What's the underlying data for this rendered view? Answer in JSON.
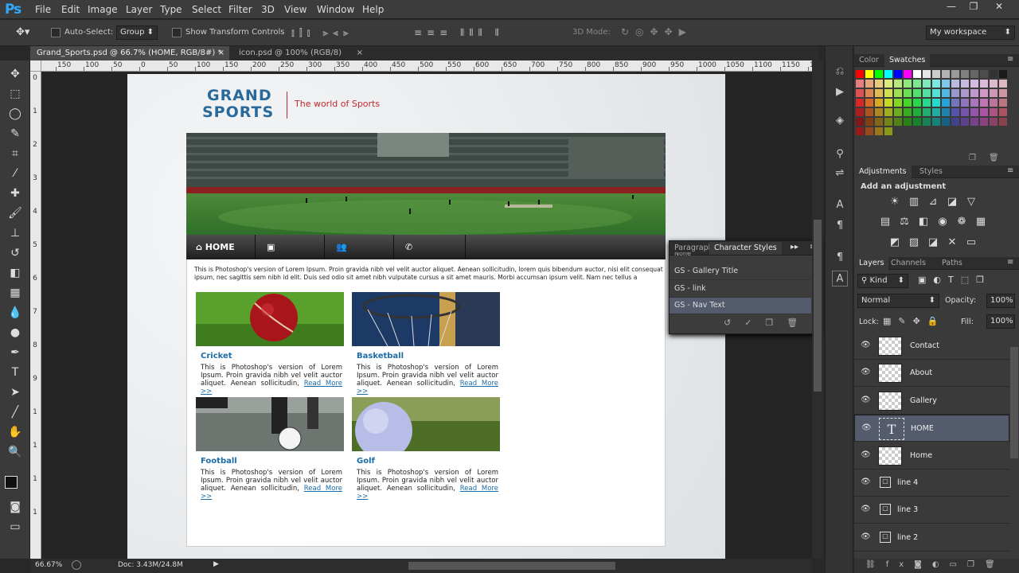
{
  "menubar": {
    "logo": "Ps",
    "items": [
      "File",
      "Edit",
      "Image",
      "Layer",
      "Type",
      "Select",
      "Filter",
      "3D",
      "View",
      "Window",
      "Help"
    ]
  },
  "options": {
    "auto_select_label": "Auto-Select:",
    "auto_select_value": "Group",
    "transform_label": "Show Transform Controls",
    "mode_3d_label": "3D Mode:",
    "workspace": "My workspace"
  },
  "tabs": [
    {
      "label": "Grand_Sports.psd @ 66.7% (HOME, RGB/8#) *"
    },
    {
      "label": "icon.psd @ 100% (RGB/8)"
    }
  ],
  "ruler": {
    "top": [
      "150",
      "100",
      "50",
      "0",
      "50",
      "100",
      "150",
      "200",
      "250",
      "300",
      "350",
      "400",
      "450",
      "500",
      "550",
      "600",
      "650",
      "700",
      "750",
      "800",
      "850",
      "900",
      "950",
      "1000",
      "1050",
      "1100",
      "1150",
      "12"
    ],
    "left": [
      "0",
      "1",
      "2",
      "3",
      "4",
      "5",
      "6",
      "7",
      "8",
      "9",
      "1",
      "1",
      "1",
      "1"
    ]
  },
  "site": {
    "logo_line1": "GRAND",
    "logo_line2": "SPORTS",
    "tagline": "The world of Sports",
    "nav_home": "HOME",
    "intro": "This is Photoshop's version  of Lorem Ipsum. Proin gravida nibh vel velit auctor aliquet. Aenean sollicitudin, lorem quis bibendum auctor, nisi elit consequat ipsum, nec sagittis sem nibh id elit. Duis sed odio sit amet nibh vulputate cursus a sit amet mauris. Morbi accumsan ipsum velit. Nam nec tellus a",
    "cards": [
      {
        "title": "Cricket",
        "text": "This is Photoshop's version  of Lorem Ipsum. Proin gravida nibh vel velit auctor aliquet. Aenean sollicitudin,",
        "more": "Read More >>"
      },
      {
        "title": "Basketball",
        "text": "This is Photoshop's version  of Lorem Ipsum. Proin gravida nibh vel velit auctor aliquet. Aenean sollicitudin,",
        "more": "Read More >>"
      },
      {
        "title": "Football",
        "text": "This is Photoshop's version  of Lorem Ipsum. Proin gravida nibh vel velit auctor aliquet. Aenean sollicitudin,",
        "more": "Read More >>"
      },
      {
        "title": "Golf",
        "text": "This is Photoshop's version  of Lorem Ipsum. Proin gravida nibh vel velit auctor aliquet. Aenean sollicitudin,",
        "more": "Read More >>"
      }
    ]
  },
  "char_panel": {
    "tab_paragraph": "Paragraph",
    "tab_char_styles": "Character Styles",
    "partial_item": "None",
    "items": [
      "GS - Gallery Title",
      "GS - link",
      "GS - Nav Text"
    ]
  },
  "status": {
    "zoom": "66.67%",
    "doc": "Doc: 3.43M/24.8M"
  },
  "color_panel": {
    "tab_color": "Color",
    "tab_swatches": "Swatches"
  },
  "adjustments": {
    "tab_adjustments": "Adjustments",
    "tab_styles": "Styles",
    "heading": "Add an adjustment"
  },
  "layers_panel": {
    "tab_layers": "Layers",
    "tab_channels": "Channels",
    "tab_paths": "Paths",
    "filter_kind": "Kind",
    "blend_mode": "Normal",
    "opacity_label": "Opacity:",
    "opacity_value": "100%",
    "lock_label": "Lock:",
    "fill_label": "Fill:",
    "fill_value": "100%",
    "layers": [
      {
        "name": "Contact",
        "kind": "pixel"
      },
      {
        "name": "About",
        "kind": "pixel"
      },
      {
        "name": "Gallery",
        "kind": "pixel"
      },
      {
        "name": "HOME",
        "kind": "text"
      },
      {
        "name": "Home",
        "kind": "pixel"
      },
      {
        "name": "line 4",
        "kind": "shape"
      },
      {
        "name": "line 3",
        "kind": "shape"
      },
      {
        "name": "line 2",
        "kind": "shape"
      }
    ]
  },
  "colors": {
    "accent": "#31a8ff",
    "link": "#1b6ca8",
    "tagline": "#c0282d",
    "selected_layer": "#545b6d"
  }
}
